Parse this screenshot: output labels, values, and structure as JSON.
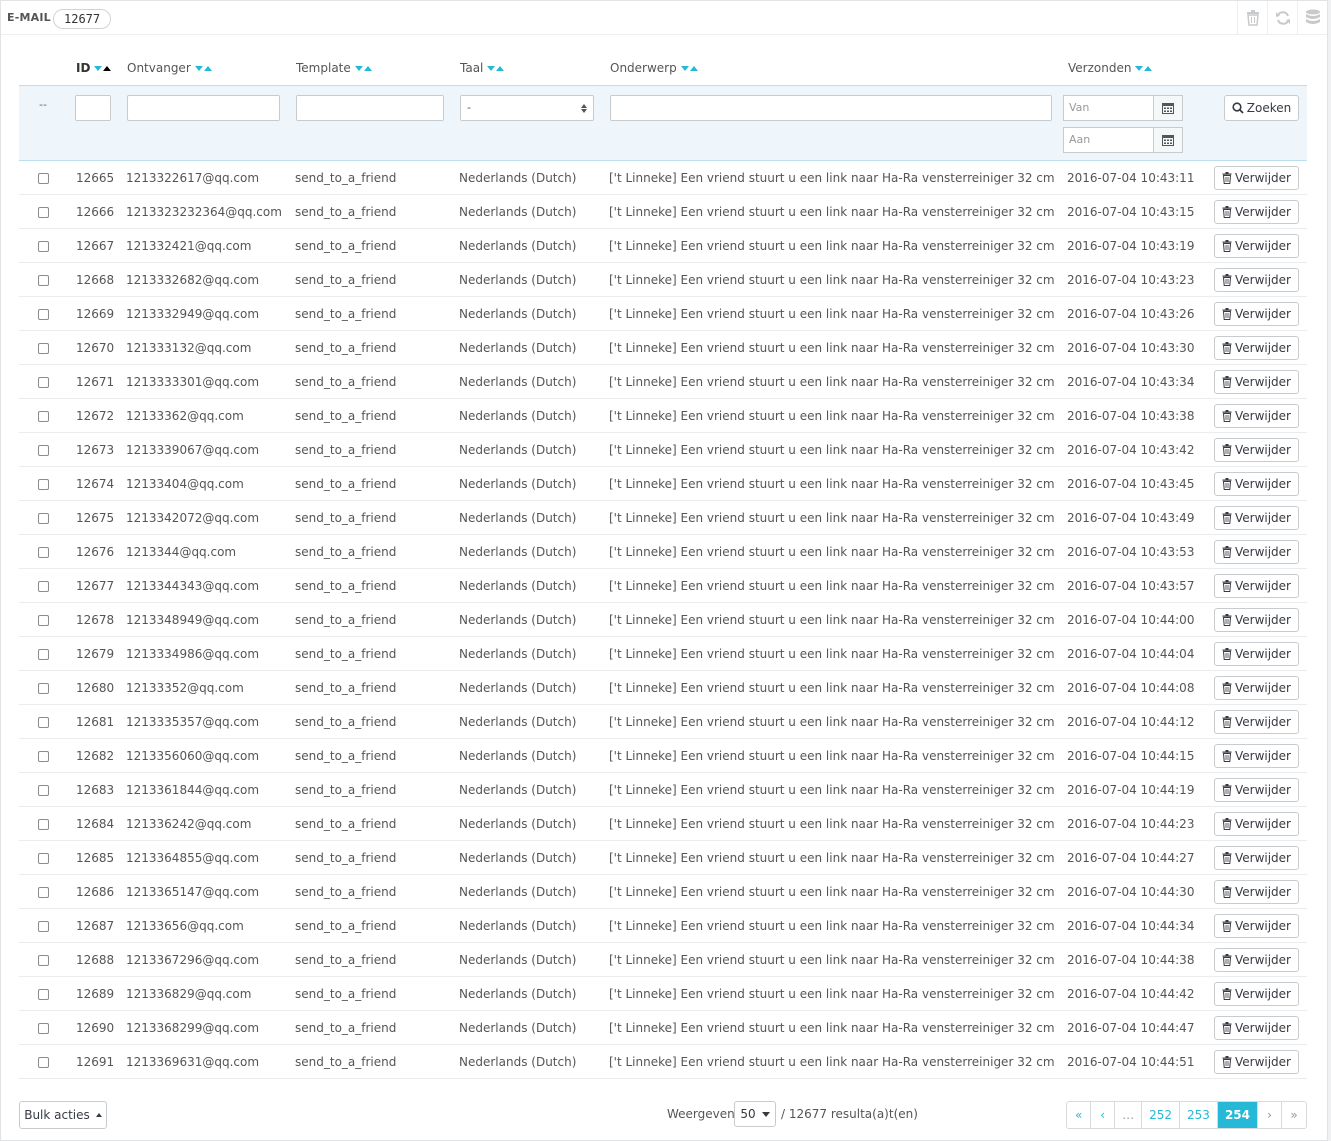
{
  "panel": {
    "title": "E-MAIL",
    "count": "12677"
  },
  "toolbar": [
    {
      "name": "trash-icon",
      "glyph": "trash"
    },
    {
      "name": "refresh-icon",
      "glyph": "refresh"
    },
    {
      "name": "database-icon",
      "glyph": "database"
    }
  ],
  "columns": {
    "id": "ID",
    "recipient": "Ontvanger",
    "template": "Template",
    "language": "Taal",
    "subject": "Onderwerp",
    "sent": "Verzonden"
  },
  "filters": {
    "dash": "--",
    "language_value": "-",
    "date_from_placeholder": "Van",
    "date_to_placeholder": "Aan",
    "search_button": "Zoeken"
  },
  "rows": [
    {
      "id": "12665",
      "recipient": "1213322617@qq.com",
      "template": "send_to_a_friend",
      "language": "Nederlands (Dutch)",
      "subject": "['t Linneke] Een vriend stuurt u een link naar Ha-Ra vensterreiniger 32 cm",
      "sent": "2016-07-04 10:43:11"
    },
    {
      "id": "12666",
      "recipient": "1213323232364@qq.com",
      "template": "send_to_a_friend",
      "language": "Nederlands (Dutch)",
      "subject": "['t Linneke] Een vriend stuurt u een link naar Ha-Ra vensterreiniger 32 cm",
      "sent": "2016-07-04 10:43:15"
    },
    {
      "id": "12667",
      "recipient": "121332421@qq.com",
      "template": "send_to_a_friend",
      "language": "Nederlands (Dutch)",
      "subject": "['t Linneke] Een vriend stuurt u een link naar Ha-Ra vensterreiniger 32 cm",
      "sent": "2016-07-04 10:43:19"
    },
    {
      "id": "12668",
      "recipient": "1213332682@qq.com",
      "template": "send_to_a_friend",
      "language": "Nederlands (Dutch)",
      "subject": "['t Linneke] Een vriend stuurt u een link naar Ha-Ra vensterreiniger 32 cm",
      "sent": "2016-07-04 10:43:23"
    },
    {
      "id": "12669",
      "recipient": "1213332949@qq.com",
      "template": "send_to_a_friend",
      "language": "Nederlands (Dutch)",
      "subject": "['t Linneke] Een vriend stuurt u een link naar Ha-Ra vensterreiniger 32 cm",
      "sent": "2016-07-04 10:43:26"
    },
    {
      "id": "12670",
      "recipient": "121333132@qq.com",
      "template": "send_to_a_friend",
      "language": "Nederlands (Dutch)",
      "subject": "['t Linneke] Een vriend stuurt u een link naar Ha-Ra vensterreiniger 32 cm",
      "sent": "2016-07-04 10:43:30"
    },
    {
      "id": "12671",
      "recipient": "1213333301@qq.com",
      "template": "send_to_a_friend",
      "language": "Nederlands (Dutch)",
      "subject": "['t Linneke] Een vriend stuurt u een link naar Ha-Ra vensterreiniger 32 cm",
      "sent": "2016-07-04 10:43:34"
    },
    {
      "id": "12672",
      "recipient": "12133362@qq.com",
      "template": "send_to_a_friend",
      "language": "Nederlands (Dutch)",
      "subject": "['t Linneke] Een vriend stuurt u een link naar Ha-Ra vensterreiniger 32 cm",
      "sent": "2016-07-04 10:43:38"
    },
    {
      "id": "12673",
      "recipient": "1213339067@qq.com",
      "template": "send_to_a_friend",
      "language": "Nederlands (Dutch)",
      "subject": "['t Linneke] Een vriend stuurt u een link naar Ha-Ra vensterreiniger 32 cm",
      "sent": "2016-07-04 10:43:42"
    },
    {
      "id": "12674",
      "recipient": "12133404@qq.com",
      "template": "send_to_a_friend",
      "language": "Nederlands (Dutch)",
      "subject": "['t Linneke] Een vriend stuurt u een link naar Ha-Ra vensterreiniger 32 cm",
      "sent": "2016-07-04 10:43:45"
    },
    {
      "id": "12675",
      "recipient": "1213342072@qq.com",
      "template": "send_to_a_friend",
      "language": "Nederlands (Dutch)",
      "subject": "['t Linneke] Een vriend stuurt u een link naar Ha-Ra vensterreiniger 32 cm",
      "sent": "2016-07-04 10:43:49"
    },
    {
      "id": "12676",
      "recipient": "1213344@qq.com",
      "template": "send_to_a_friend",
      "language": "Nederlands (Dutch)",
      "subject": "['t Linneke] Een vriend stuurt u een link naar Ha-Ra vensterreiniger 32 cm",
      "sent": "2016-07-04 10:43:53"
    },
    {
      "id": "12677",
      "recipient": "1213344343@qq.com",
      "template": "send_to_a_friend",
      "language": "Nederlands (Dutch)",
      "subject": "['t Linneke] Een vriend stuurt u een link naar Ha-Ra vensterreiniger 32 cm",
      "sent": "2016-07-04 10:43:57"
    },
    {
      "id": "12678",
      "recipient": "1213348949@qq.com",
      "template": "send_to_a_friend",
      "language": "Nederlands (Dutch)",
      "subject": "['t Linneke] Een vriend stuurt u een link naar Ha-Ra vensterreiniger 32 cm",
      "sent": "2016-07-04 10:44:00"
    },
    {
      "id": "12679",
      "recipient": "1213334986@qq.com",
      "template": "send_to_a_friend",
      "language": "Nederlands (Dutch)",
      "subject": "['t Linneke] Een vriend stuurt u een link naar Ha-Ra vensterreiniger 32 cm",
      "sent": "2016-07-04 10:44:04"
    },
    {
      "id": "12680",
      "recipient": "12133352@qq.com",
      "template": "send_to_a_friend",
      "language": "Nederlands (Dutch)",
      "subject": "['t Linneke] Een vriend stuurt u een link naar Ha-Ra vensterreiniger 32 cm",
      "sent": "2016-07-04 10:44:08"
    },
    {
      "id": "12681",
      "recipient": "1213335357@qq.com",
      "template": "send_to_a_friend",
      "language": "Nederlands (Dutch)",
      "subject": "['t Linneke] Een vriend stuurt u een link naar Ha-Ra vensterreiniger 32 cm",
      "sent": "2016-07-04 10:44:12"
    },
    {
      "id": "12682",
      "recipient": "1213356060@qq.com",
      "template": "send_to_a_friend",
      "language": "Nederlands (Dutch)",
      "subject": "['t Linneke] Een vriend stuurt u een link naar Ha-Ra vensterreiniger 32 cm",
      "sent": "2016-07-04 10:44:15"
    },
    {
      "id": "12683",
      "recipient": "1213361844@qq.com",
      "template": "send_to_a_friend",
      "language": "Nederlands (Dutch)",
      "subject": "['t Linneke] Een vriend stuurt u een link naar Ha-Ra vensterreiniger 32 cm",
      "sent": "2016-07-04 10:44:19"
    },
    {
      "id": "12684",
      "recipient": "121336242@qq.com",
      "template": "send_to_a_friend",
      "language": "Nederlands (Dutch)",
      "subject": "['t Linneke] Een vriend stuurt u een link naar Ha-Ra vensterreiniger 32 cm",
      "sent": "2016-07-04 10:44:23"
    },
    {
      "id": "12685",
      "recipient": "1213364855@qq.com",
      "template": "send_to_a_friend",
      "language": "Nederlands (Dutch)",
      "subject": "['t Linneke] Een vriend stuurt u een link naar Ha-Ra vensterreiniger 32 cm",
      "sent": "2016-07-04 10:44:27"
    },
    {
      "id": "12686",
      "recipient": "1213365147@qq.com",
      "template": "send_to_a_friend",
      "language": "Nederlands (Dutch)",
      "subject": "['t Linneke] Een vriend stuurt u een link naar Ha-Ra vensterreiniger 32 cm",
      "sent": "2016-07-04 10:44:30"
    },
    {
      "id": "12687",
      "recipient": "12133656@qq.com",
      "template": "send_to_a_friend",
      "language": "Nederlands (Dutch)",
      "subject": "['t Linneke] Een vriend stuurt u een link naar Ha-Ra vensterreiniger 32 cm",
      "sent": "2016-07-04 10:44:34"
    },
    {
      "id": "12688",
      "recipient": "1213367296@qq.com",
      "template": "send_to_a_friend",
      "language": "Nederlands (Dutch)",
      "subject": "['t Linneke] Een vriend stuurt u een link naar Ha-Ra vensterreiniger 32 cm",
      "sent": "2016-07-04 10:44:38"
    },
    {
      "id": "12689",
      "recipient": "121336829@qq.com",
      "template": "send_to_a_friend",
      "language": "Nederlands (Dutch)",
      "subject": "['t Linneke] Een vriend stuurt u een link naar Ha-Ra vensterreiniger 32 cm",
      "sent": "2016-07-04 10:44:42"
    },
    {
      "id": "12690",
      "recipient": "1213368299@qq.com",
      "template": "send_to_a_friend",
      "language": "Nederlands (Dutch)",
      "subject": "['t Linneke] Een vriend stuurt u een link naar Ha-Ra vensterreiniger 32 cm",
      "sent": "2016-07-04 10:44:47"
    },
    {
      "id": "12691",
      "recipient": "1213369631@qq.com",
      "template": "send_to_a_friend",
      "language": "Nederlands (Dutch)",
      "subject": "['t Linneke] Een vriend stuurt u een link naar Ha-Ra vensterreiniger 32 cm",
      "sent": "2016-07-04 10:44:51"
    }
  ],
  "row_action_label": "Verwijder",
  "footer": {
    "bulk_label": "Bulk acties",
    "show_label": "Weergeven",
    "per_page": "50",
    "results_text": "/ 12677 resulta(a)t(en)"
  },
  "pagination": {
    "first": "«",
    "prev": "‹",
    "ellipsis": "…",
    "pages": [
      "252",
      "253",
      "254"
    ],
    "current": "254",
    "next": "›",
    "last": "»"
  },
  "colors": {
    "accent": "#25b9d7",
    "filter_bg": "#eef6fb",
    "border": "#d7dadc"
  }
}
